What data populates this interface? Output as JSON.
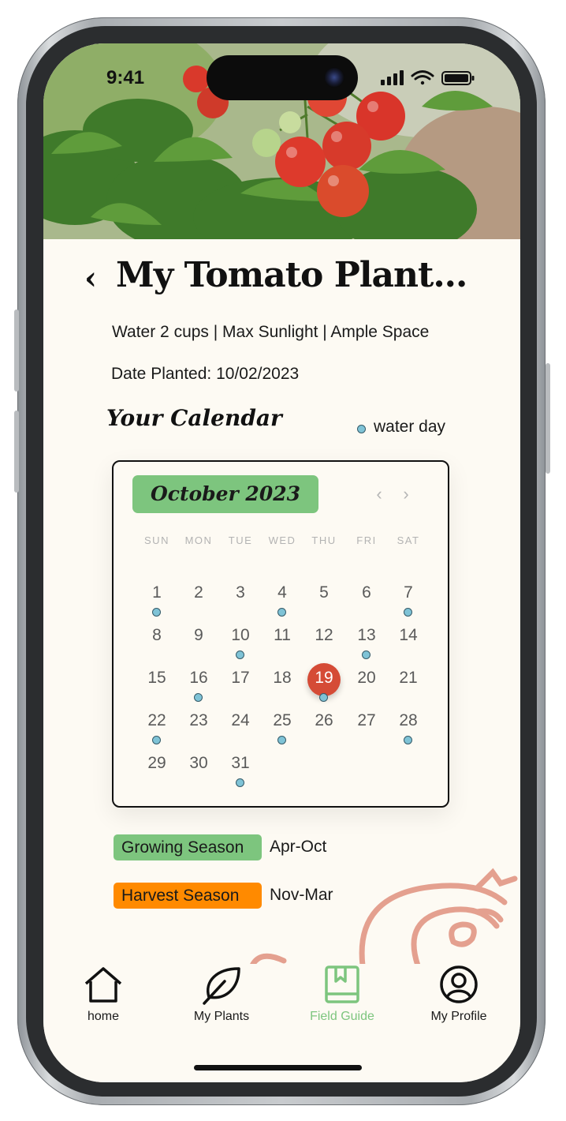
{
  "status": {
    "time": "9:41"
  },
  "header": {
    "back_icon": "chevron-left-icon",
    "title": "My Tomato Plant...",
    "care": "Water 2 cups | Max Sunlight | Ample Space",
    "date_planted": "Date Planted: 10/02/2023"
  },
  "calendar": {
    "heading": "Your Calendar",
    "legend": {
      "label": "water day",
      "color": "#7fc3d6"
    },
    "month": "October 2023",
    "weekdays": [
      "SUN",
      "MON",
      "TUE",
      "WED",
      "THU",
      "FRI",
      "SAT"
    ],
    "days": [
      "1",
      "2",
      "3",
      "4",
      "5",
      "6",
      "7",
      "8",
      "9",
      "10",
      "11",
      "12",
      "13",
      "14",
      "15",
      "16",
      "17",
      "18",
      "19",
      "20",
      "21",
      "22",
      "23",
      "24",
      "25",
      "26",
      "27",
      "28",
      "29",
      "30",
      "31"
    ],
    "first_weekday_index": 0,
    "water_days": [
      1,
      4,
      7,
      10,
      13,
      16,
      19,
      22,
      25,
      28,
      31
    ],
    "selected_day": 19,
    "selected_color": "#d54b36"
  },
  "seasons": [
    {
      "label": "Growing Season",
      "range": "Apr-Oct",
      "color": "#7dc57e"
    },
    {
      "label": "Harvest Season",
      "range": "Nov-Mar",
      "color": "#ff8a00"
    }
  ],
  "tabs": [
    {
      "label": "home",
      "icon": "house-icon",
      "active": false
    },
    {
      "label": "My Plants",
      "icon": "leaf-icon",
      "active": false
    },
    {
      "label": "Field Guide",
      "icon": "book-icon",
      "active": true
    },
    {
      "label": "My Profile",
      "icon": "user-circle-icon",
      "active": false
    }
  ],
  "colors": {
    "accent_green": "#7dc57e",
    "accent_orange": "#ff8a00",
    "background": "#fdfaf3"
  }
}
